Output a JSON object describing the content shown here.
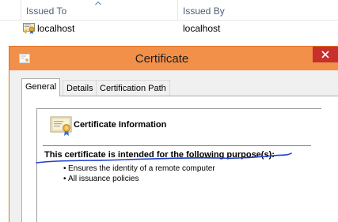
{
  "list": {
    "columns": {
      "issued_to": "Issued To",
      "issued_by": "Issued By"
    },
    "rows": [
      {
        "issued_to": "localhost",
        "issued_by": "localhost"
      }
    ]
  },
  "dialog": {
    "title": "Certificate",
    "tabs": [
      "General",
      "Details",
      "Certification Path"
    ],
    "active_tab": "General",
    "info": {
      "heading": "Certificate Information",
      "purpose_heading": "This certificate is intended for the following purpose(s):",
      "purposes": [
        "Ensures the identity of a remote computer",
        "All issuance policies"
      ]
    }
  },
  "colors": {
    "titlebar": "#f29049",
    "close_button": "#c7302b",
    "annotation_ink": "#1f3fcf"
  },
  "icons": {
    "title": "certificate-small-icon",
    "row": "certificate-row-icon",
    "info": "certificate-ribbon-icon",
    "close": "close-icon",
    "sort": "sort-ascending-icon"
  }
}
